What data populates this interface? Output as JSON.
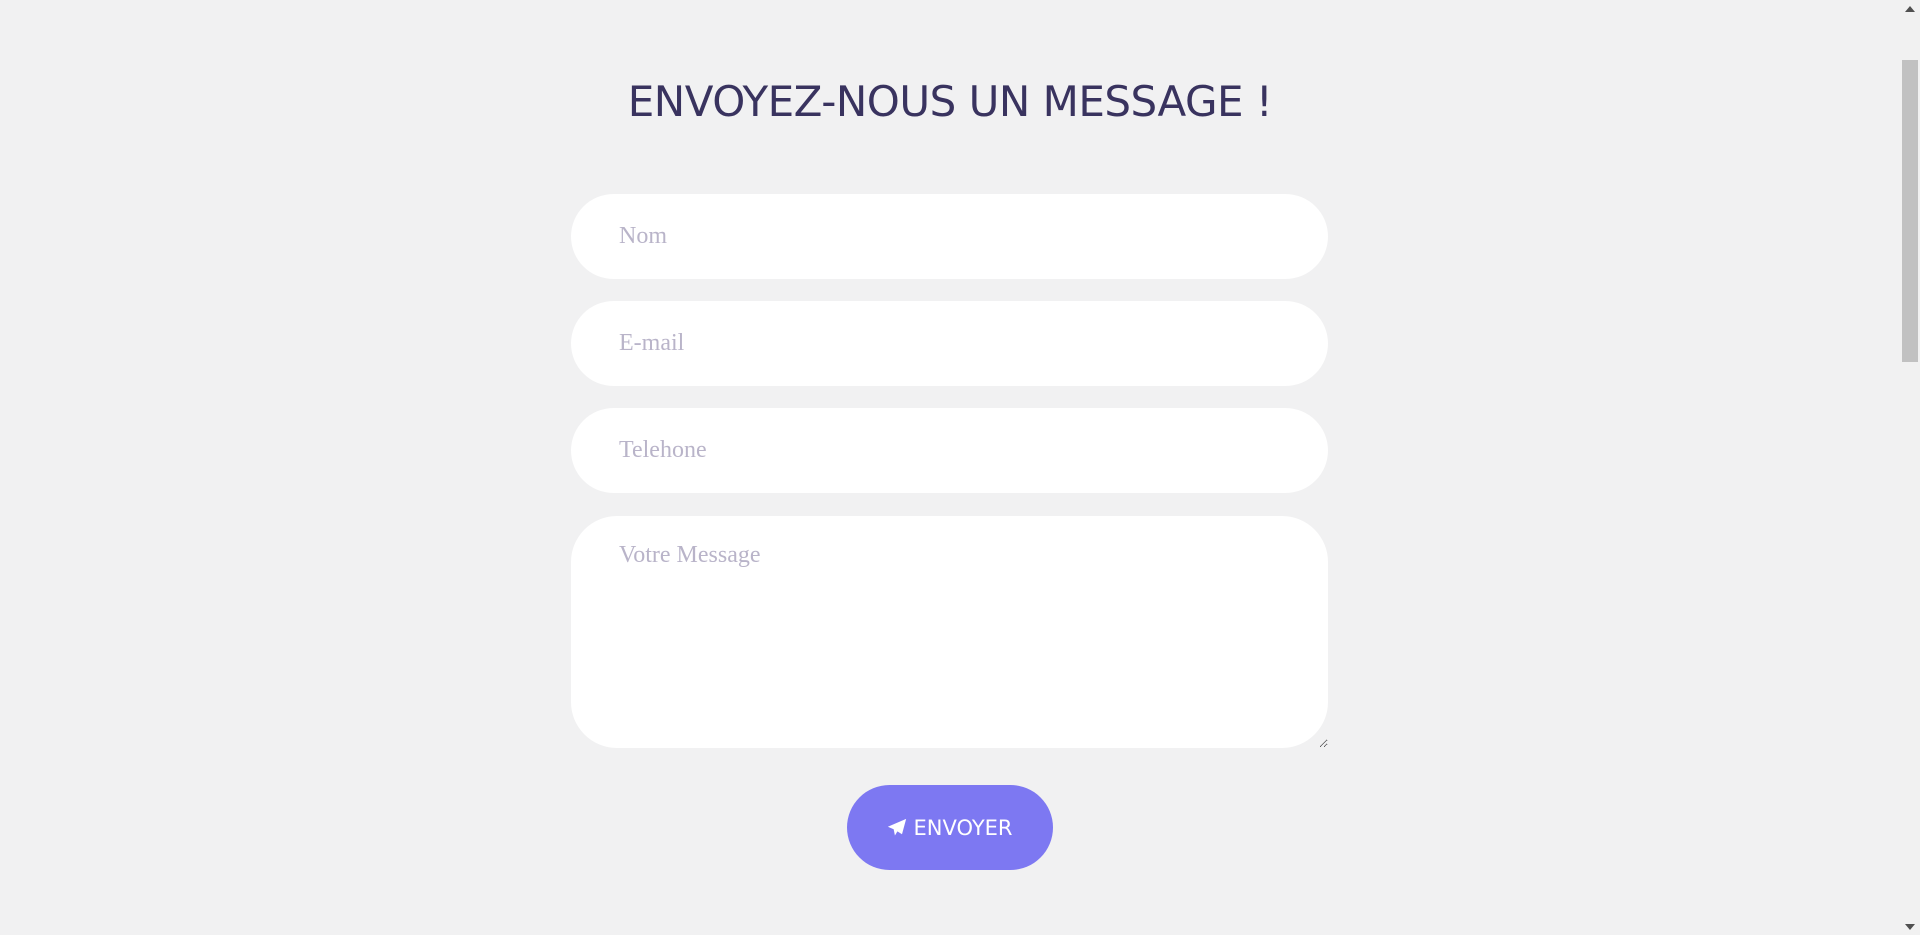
{
  "contact": {
    "title": "ENVOYEZ-NOUS UN MESSAGE !",
    "name_placeholder": "Nom",
    "email_placeholder": "E-mail",
    "phone_placeholder": "Telehone",
    "message_placeholder": "Votre Message",
    "send_label": "ENVOYER",
    "send_icon": "paper-plane-icon"
  },
  "colors": {
    "background": "#f1f1f2",
    "title": "#39335f",
    "placeholder": "#b9b4c9",
    "button": "#7d78f2",
    "button_text": "#ffffff"
  }
}
